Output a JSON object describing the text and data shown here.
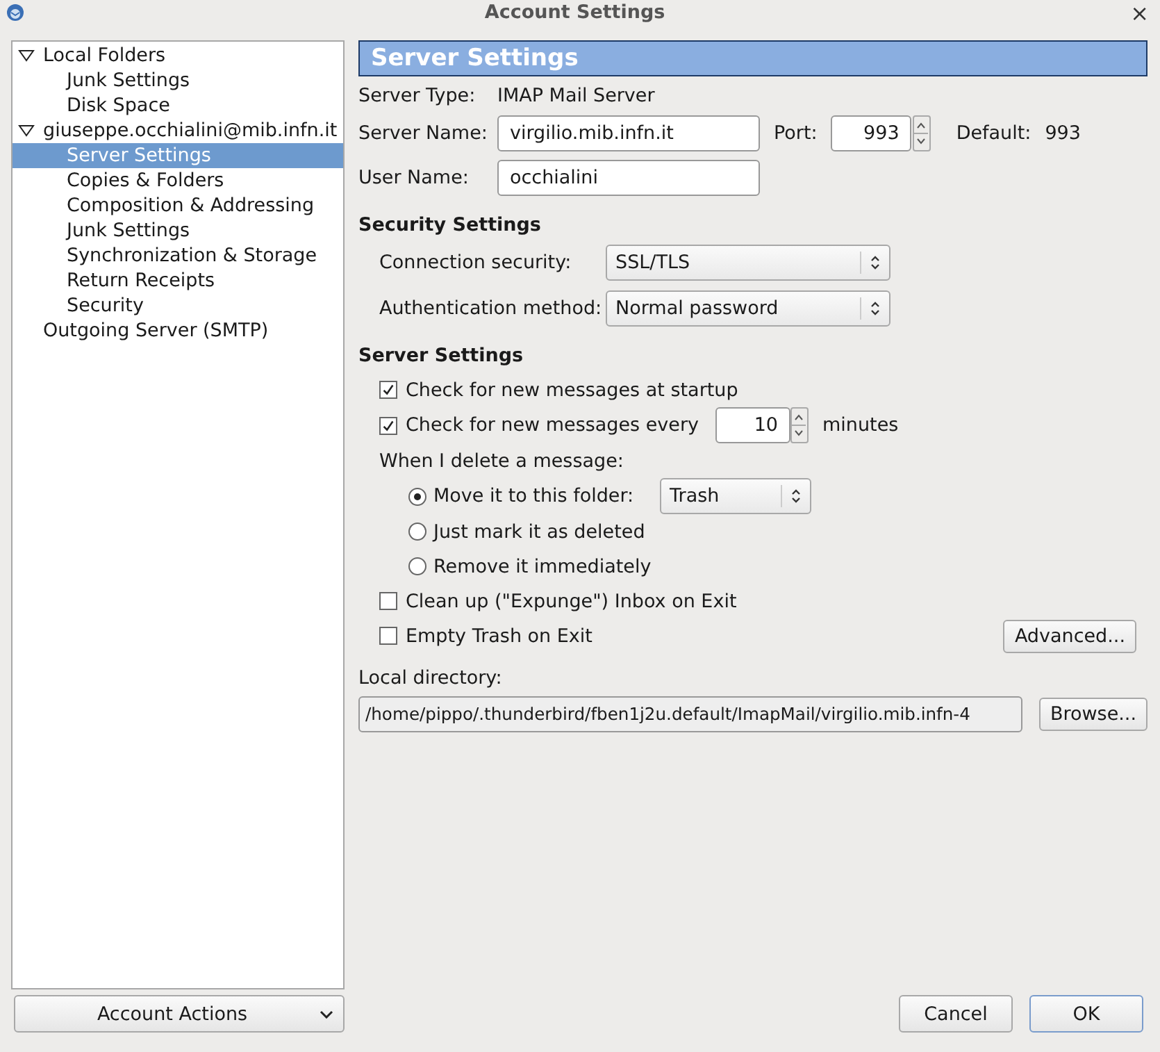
{
  "window": {
    "title": "Account Settings",
    "close": "×"
  },
  "tree": [
    {
      "label": "Local Folders",
      "selected": false,
      "expanded": true,
      "children": [
        {
          "label": "Junk Settings",
          "selected": false
        },
        {
          "label": "Disk Space",
          "selected": false
        }
      ]
    },
    {
      "label": "giuseppe.occhialini@mib.infn.it",
      "selected": false,
      "expanded": true,
      "children": [
        {
          "label": "Server Settings",
          "selected": true
        },
        {
          "label": "Copies & Folders",
          "selected": false
        },
        {
          "label": "Composition & Addressing",
          "selected": false
        },
        {
          "label": "Junk Settings",
          "selected": false
        },
        {
          "label": "Synchronization & Storage",
          "selected": false
        },
        {
          "label": "Return Receipts",
          "selected": false
        },
        {
          "label": "Security",
          "selected": false
        }
      ]
    },
    {
      "label": "Outgoing Server (SMTP)",
      "selected": false
    }
  ],
  "account_actions": "Account Actions",
  "page_title": "Server Settings",
  "server_type": {
    "label": "Server Type:",
    "value": "IMAP Mail Server"
  },
  "server_name": {
    "label": "Server Name:",
    "value": "virgilio.mib.infn.it"
  },
  "port": {
    "label": "Port:",
    "value": "993",
    "default_label": "Default:",
    "default_value": "993"
  },
  "user_name": {
    "label": "User Name:",
    "value": "occhialini"
  },
  "security": {
    "heading": "Security Settings",
    "connection_label": "Connection security:",
    "connection_value": "SSL/TLS",
    "auth_label": "Authentication method:",
    "auth_value": "Normal password"
  },
  "server": {
    "heading": "Server Settings",
    "check_startup": {
      "label": "Check for new messages at startup",
      "checked": true
    },
    "check_every": {
      "label": "Check for new messages every",
      "checked": true,
      "value": "10",
      "unit": "minutes"
    },
    "delete_label": "When I delete a message:",
    "delete_options": [
      {
        "label": "Move it to this folder:",
        "selected": true,
        "folder": "Trash"
      },
      {
        "label": "Just mark it as deleted",
        "selected": false
      },
      {
        "label": "Remove it immediately",
        "selected": false
      }
    ],
    "expunge": {
      "label": "Clean up (\"Expunge\") Inbox on Exit",
      "checked": false
    },
    "empty_trash": {
      "label": "Empty Trash on Exit",
      "checked": false
    },
    "advanced": "Advanced..."
  },
  "local_directory": {
    "label": "Local directory:",
    "value": "/home/pippo/.thunderbird/fben1j2u.default/ImapMail/virgilio.mib.infn-4",
    "browse": "Browse..."
  },
  "buttons": [
    {
      "label": "Cancel",
      "default": false
    },
    {
      "label": "OK",
      "default": true
    }
  ]
}
